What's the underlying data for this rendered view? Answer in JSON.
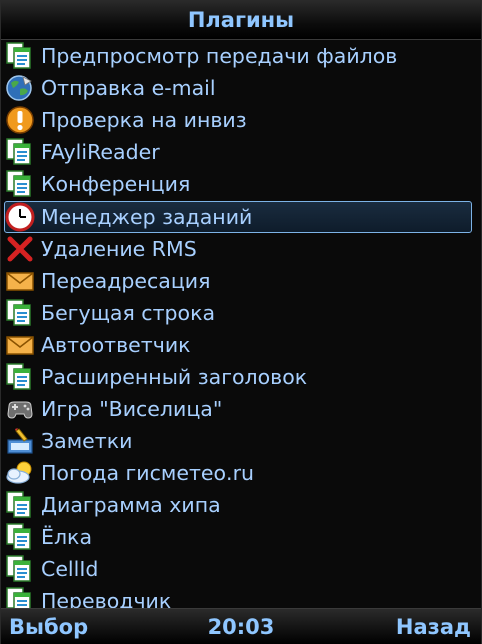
{
  "header": {
    "title": "Плагины"
  },
  "list": {
    "items": [
      {
        "label": "Предпросмотр передачи файлов",
        "icon": "document-icon"
      },
      {
        "label": "Отправка e-mail",
        "icon": "globe-icon"
      },
      {
        "label": "Проверка на инвиз",
        "icon": "exclamation-icon"
      },
      {
        "label": "FAyliReader",
        "icon": "document-icon"
      },
      {
        "label": "Конференция",
        "icon": "document-icon"
      },
      {
        "label": "Менеджер заданий",
        "icon": "clock-icon",
        "selected": true
      },
      {
        "label": "Удаление RMS",
        "icon": "red-x-icon"
      },
      {
        "label": "Переадресация",
        "icon": "envelope-icon"
      },
      {
        "label": "Бегущая строка",
        "icon": "document-icon"
      },
      {
        "label": "Автоответчик",
        "icon": "envelope-icon"
      },
      {
        "label": "Расширенный заголовок",
        "icon": "document-icon"
      },
      {
        "label": "Игра \"Виселица\"",
        "icon": "gamepad-icon"
      },
      {
        "label": "Заметки",
        "icon": "notes-icon"
      },
      {
        "label": "Погода гисметео.ru",
        "icon": "weather-icon"
      },
      {
        "label": "Диаграмма хипа",
        "icon": "document-icon"
      },
      {
        "label": "Ёлка",
        "icon": "document-icon"
      },
      {
        "label": "CellId",
        "icon": "document-icon"
      },
      {
        "label": "Переводчик",
        "icon": "document-icon"
      }
    ]
  },
  "footer": {
    "left_softkey": "Выбор",
    "clock": "20:03",
    "right_softkey": "Назад"
  }
}
